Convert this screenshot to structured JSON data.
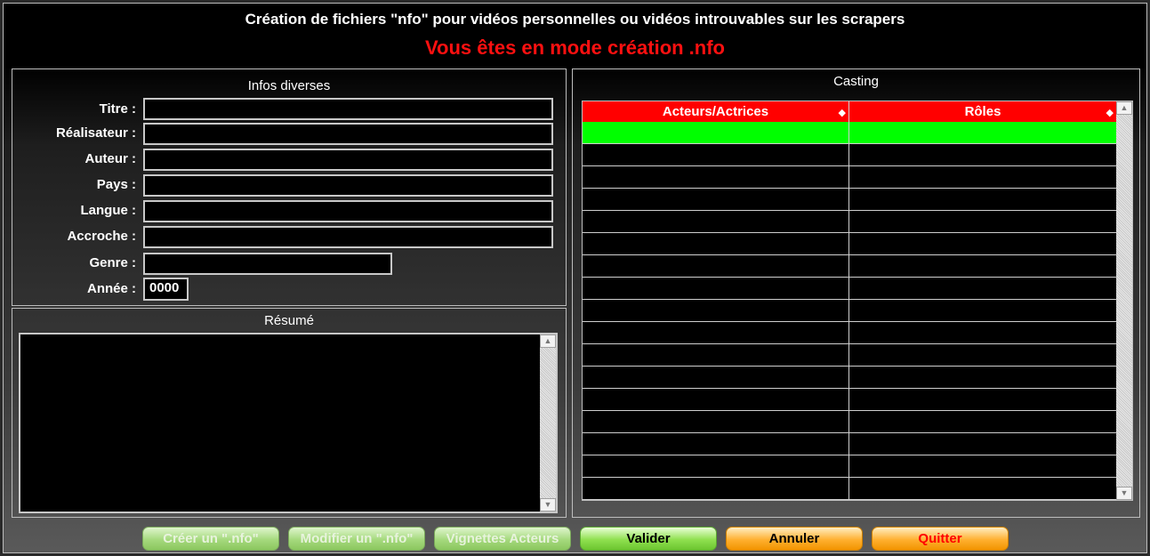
{
  "header": {
    "title": "Création de fichiers \"nfo\" pour vidéos personnelles ou vidéos introuvables sur les scrapers",
    "mode_message": "Vous êtes en mode création .nfo"
  },
  "infos": {
    "group_title": "Infos diverses",
    "fields": [
      {
        "label": "Titre :",
        "value": ""
      },
      {
        "label": "Réalisateur :",
        "value": ""
      },
      {
        "label": "Auteur :",
        "value": ""
      },
      {
        "label": "Pays :",
        "value": ""
      },
      {
        "label": "Langue :",
        "value": ""
      },
      {
        "label": "Accroche :",
        "value": ""
      },
      {
        "label": "Genre :",
        "value": ""
      },
      {
        "label": "Année :",
        "value": "0000"
      }
    ]
  },
  "resume": {
    "group_title": "Résumé",
    "value": ""
  },
  "casting": {
    "group_title": "Casting",
    "columns": [
      "Acteurs/Actrices",
      "Rôles"
    ],
    "selected_row": 0,
    "row_count": 17
  },
  "buttons": {
    "create": "Créer un \".nfo\"",
    "modify": "Modifier un \".nfo\"",
    "vignettes": "Vignettes Acteurs",
    "validate": "Valider",
    "cancel": "Annuler",
    "quit": "Quitter"
  },
  "colors": {
    "header_red": "#ff0000",
    "selected_row": "#00ff00",
    "button_green": "#8fe04f",
    "button_orange": "#ffb030"
  }
}
